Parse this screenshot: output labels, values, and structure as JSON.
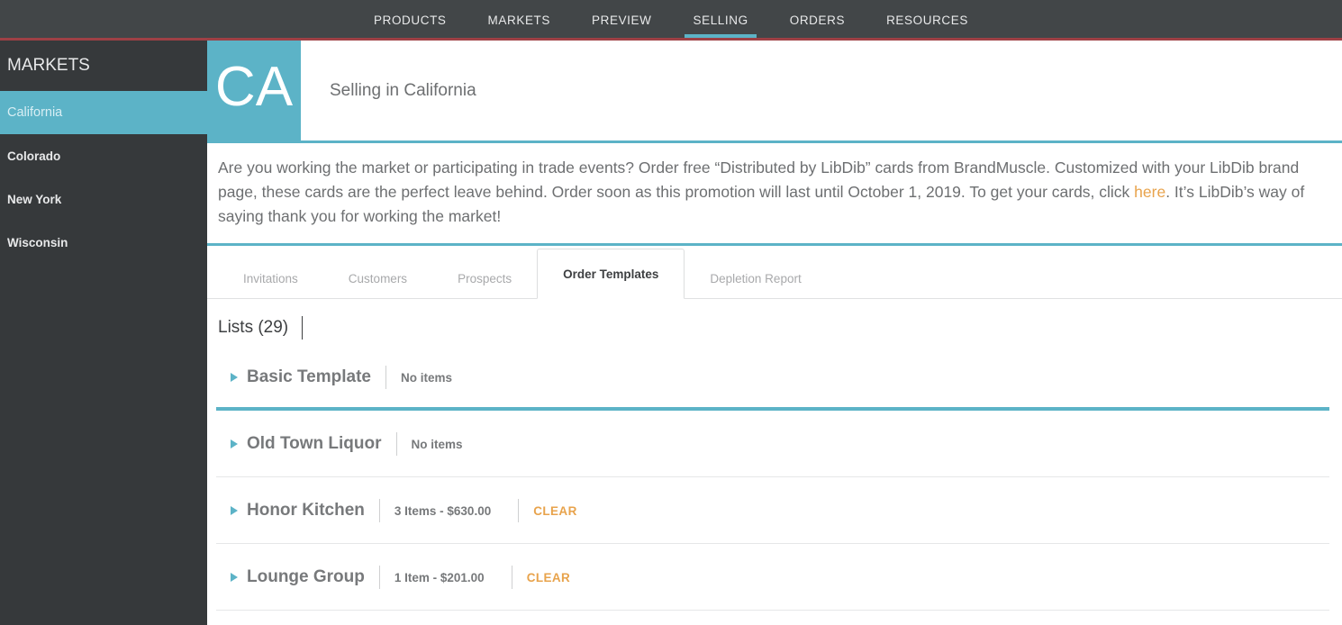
{
  "topnav": {
    "items": [
      {
        "label": "PRODUCTS",
        "active": false
      },
      {
        "label": "MARKETS",
        "active": false
      },
      {
        "label": "PREVIEW",
        "active": false
      },
      {
        "label": "SELLING",
        "active": true
      },
      {
        "label": "ORDERS",
        "active": false
      },
      {
        "label": "RESOURCES",
        "active": false
      }
    ]
  },
  "sidebar": {
    "title": "MARKETS",
    "items": [
      {
        "label": "California",
        "active": true
      },
      {
        "label": "Colorado",
        "active": false
      },
      {
        "label": "New York",
        "active": false
      },
      {
        "label": "Wisconsin",
        "active": false
      }
    ]
  },
  "market_header": {
    "badge": "CA",
    "title": "Selling in California"
  },
  "announcement": {
    "text_before_link": "Are you working the market or participating in trade events? Order free “Distributed by LibDib” cards from BrandMuscle. Customized with your LibDib brand page, these cards are the perfect leave behind. Order soon as this promotion will last until October 1, 2019. To get your cards, click ",
    "link_text": "here",
    "text_after_link": ". It’s LibDib’s way of saying thank you for working the market!"
  },
  "tabs": [
    {
      "label": "Invitations",
      "active": false
    },
    {
      "label": "Customers",
      "active": false
    },
    {
      "label": "Prospects",
      "active": false
    },
    {
      "label": "Order Templates",
      "active": true
    },
    {
      "label": "Depletion Report",
      "active": false
    }
  ],
  "lists": {
    "heading": "Lists (29)",
    "rows": [
      {
        "name": "Basic Template",
        "meta": "No items",
        "clear_label": null,
        "accent": true
      },
      {
        "name": "Old Town Liquor",
        "meta": "No items",
        "clear_label": null,
        "accent": false
      },
      {
        "name": "Honor Kitchen",
        "meta": "3 Items - $630.00",
        "clear_label": "CLEAR",
        "accent": false
      },
      {
        "name": "Lounge Group",
        "meta": "1 Item - $201.00",
        "clear_label": "CLEAR",
        "accent": false
      }
    ]
  },
  "colors": {
    "teal": "#5cb3c7",
    "dark": "#424648",
    "sidebar_dark": "#36393b",
    "red_stripe": "#9e4045",
    "orange_link": "#e8a34c",
    "body_text": "#6d6f71"
  }
}
